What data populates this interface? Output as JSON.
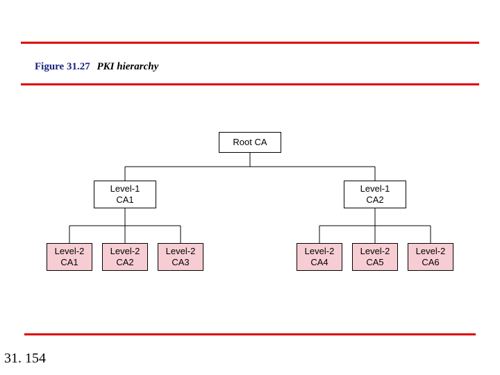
{
  "caption": {
    "fignum": "Figure 31.27",
    "title": "PKI hierarchy"
  },
  "page_number": "31. 154",
  "nodes": {
    "root": {
      "line1": "Root CA",
      "line2": ""
    },
    "l1a": {
      "line1": "Level-1",
      "line2": "CA1"
    },
    "l1b": {
      "line1": "Level-1",
      "line2": "CA2"
    },
    "l2_1": {
      "line1": "Level-2",
      "line2": "CA1"
    },
    "l2_2": {
      "line1": "Level-2",
      "line2": "CA2"
    },
    "l2_3": {
      "line1": "Level-2",
      "line2": "CA3"
    },
    "l2_4": {
      "line1": "Level-2",
      "line2": "CA4"
    },
    "l2_5": {
      "line1": "Level-2",
      "line2": "CA5"
    },
    "l2_6": {
      "line1": "Level-2",
      "line2": "CA6"
    }
  }
}
